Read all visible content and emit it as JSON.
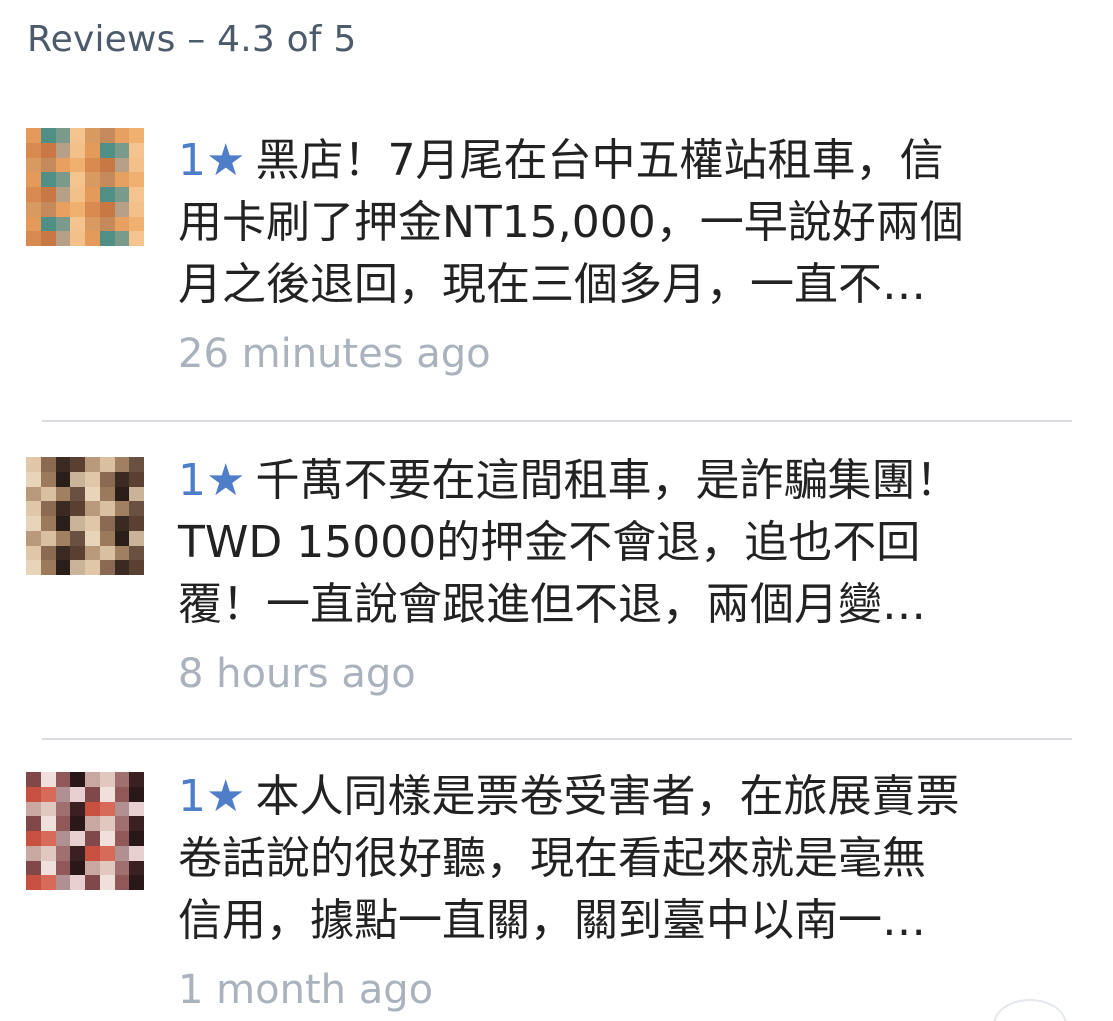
{
  "header": {
    "title": "Reviews – 4.3 of 5"
  },
  "reviews": [
    {
      "rating_label": "1★",
      "lines": [
        "黑店！7月尾在台中五權站租車，信",
        "用卡刷了押金NT15,000，一早說好兩個",
        "月之後退回，現在三個多月，一直不…"
      ],
      "time": "26 minutes ago"
    },
    {
      "rating_label": "1★",
      "lines": [
        "千萬不要在這間租車，是詐騙集團！",
        "TWD 15000的押金不會退，追也不回",
        "覆！一直說會跟進但不退，兩個月變…"
      ],
      "time": "8 hours ago"
    },
    {
      "rating_label": "1★",
      "lines": [
        "本人同樣是票卷受害者，在旅展賣票",
        "卷話說的很好聽，現在看起來就是毫無",
        "信用，據點一直關，關到臺中以南一…"
      ],
      "time": "1 month ago"
    }
  ],
  "colors": {
    "header": "#4b5b6b",
    "star": "#4f7ec8",
    "text": "#222222",
    "time": "#a9b2bd",
    "divider": "#dadde2"
  }
}
